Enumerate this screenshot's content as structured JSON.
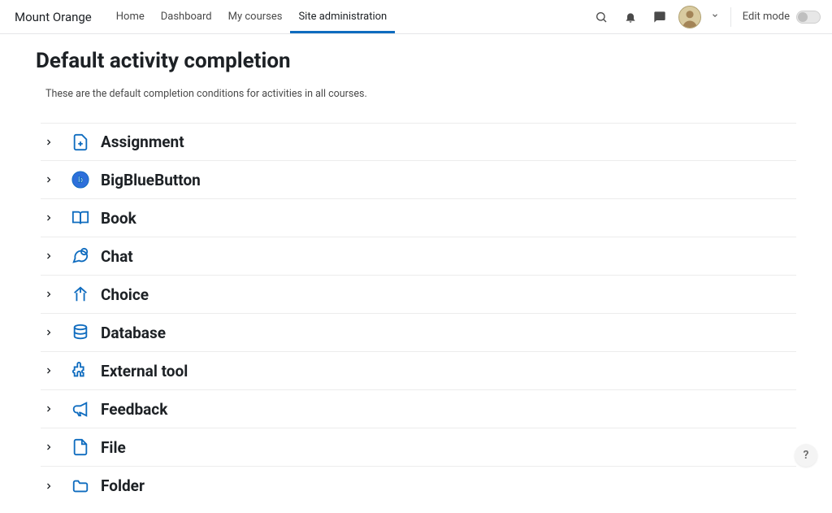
{
  "brand": "Mount Orange",
  "nav": {
    "home": "Home",
    "dashboard": "Dashboard",
    "mycourses": "My courses",
    "siteadmin": "Site administration",
    "active": "siteadmin"
  },
  "editmode_label": "Edit mode",
  "page": {
    "title": "Default activity completion",
    "subtitle": "These are the default completion conditions for activities in all courses."
  },
  "activities": [
    {
      "id": "assignment",
      "label": "Assignment",
      "icon": "assignment-icon"
    },
    {
      "id": "bigbluebutton",
      "label": "BigBlueButton",
      "icon": "bigbluebutton-icon"
    },
    {
      "id": "book",
      "label": "Book",
      "icon": "book-icon"
    },
    {
      "id": "chat",
      "label": "Chat",
      "icon": "chat-icon"
    },
    {
      "id": "choice",
      "label": "Choice",
      "icon": "choice-icon"
    },
    {
      "id": "database",
      "label": "Database",
      "icon": "database-icon"
    },
    {
      "id": "external",
      "label": "External tool",
      "icon": "puzzle-icon"
    },
    {
      "id": "feedback",
      "label": "Feedback",
      "icon": "megaphone-icon"
    },
    {
      "id": "file",
      "label": "File",
      "icon": "file-icon"
    },
    {
      "id": "folder",
      "label": "Folder",
      "icon": "folder-icon"
    }
  ],
  "help": "?"
}
